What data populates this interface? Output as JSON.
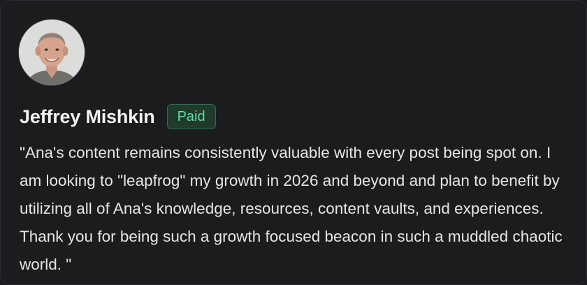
{
  "testimonial": {
    "author_name": "Jeffrey Mishkin",
    "badge_label": "Paid",
    "quote": "\"Ana's content remains consistently valuable with every post being spot on. I am looking to \"leapfrog\" my growth in 2026 and beyond and plan to benefit by utilizing all of Ana's knowledge, resources, content vaults, and experiences. Thank you for being such a growth focused beacon in such a muddled chaotic world. \""
  },
  "colors": {
    "background": "#1b1c1e",
    "badge_text": "#5fe0a0",
    "badge_background": "#1e3b2c",
    "badge_border": "#2f6e4d",
    "text": "#e6e6e6"
  }
}
